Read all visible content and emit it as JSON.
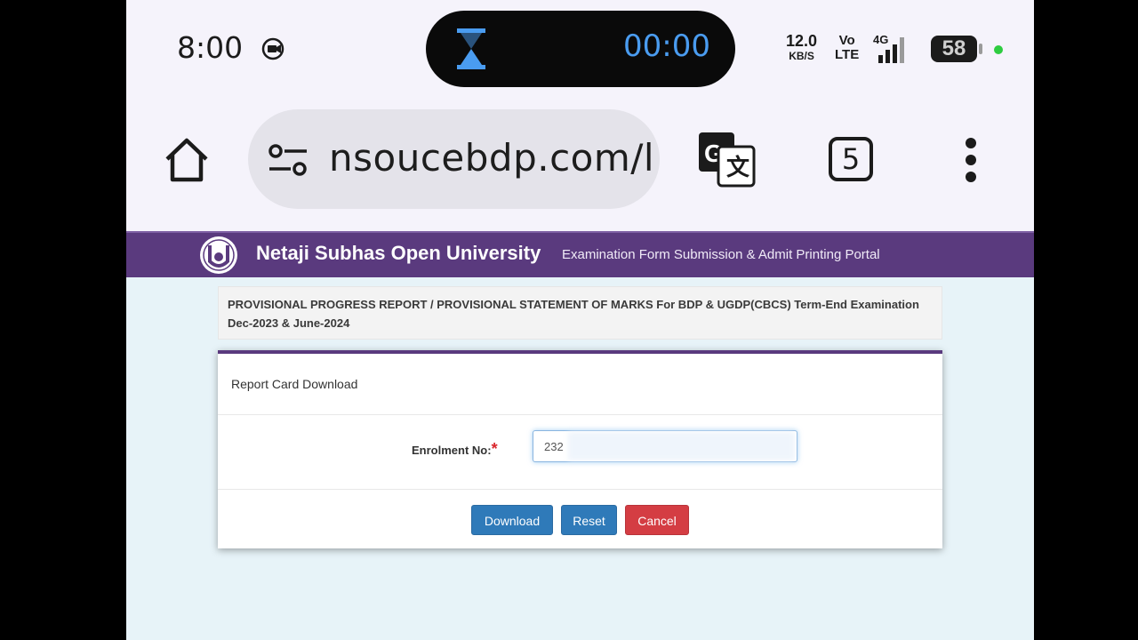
{
  "status_bar": {
    "time": "8:00",
    "timer": "00:00",
    "net_speed_value": "12.0",
    "net_speed_unit": "KB/S",
    "volte_top": "Vo",
    "volte_bottom": "LTE",
    "network": "4G",
    "battery": "58",
    "icons": [
      "screen-record-icon",
      "hourglass-icon",
      "signal-icon",
      "battery-icon"
    ]
  },
  "browser": {
    "url": "nsoucebdp.com/l",
    "tab_count": "5",
    "icons": [
      "home-icon",
      "site-settings-icon",
      "translate-icon",
      "more-vert-icon"
    ]
  },
  "site": {
    "title": "Netaji Subhas Open University",
    "subtitle": "Examination Form Submission & Admit Printing Portal",
    "header_color": "#5a3a7e"
  },
  "notice": "PROVISIONAL PROGRESS REPORT / PROVISIONAL STATEMENT OF MARKS For BDP & UGDP(CBCS) Term-End Examination Dec-2023 & June-2024",
  "form": {
    "card_title": "Report Card Download",
    "enrolment_label": "Enrolment No:",
    "required_mark": "*",
    "enrolment_value": "232",
    "buttons": {
      "download": "Download",
      "reset": "Reset",
      "cancel": "Cancel"
    },
    "colors": {
      "primary": "#2f7ab9",
      "danger": "#d43d43"
    }
  }
}
